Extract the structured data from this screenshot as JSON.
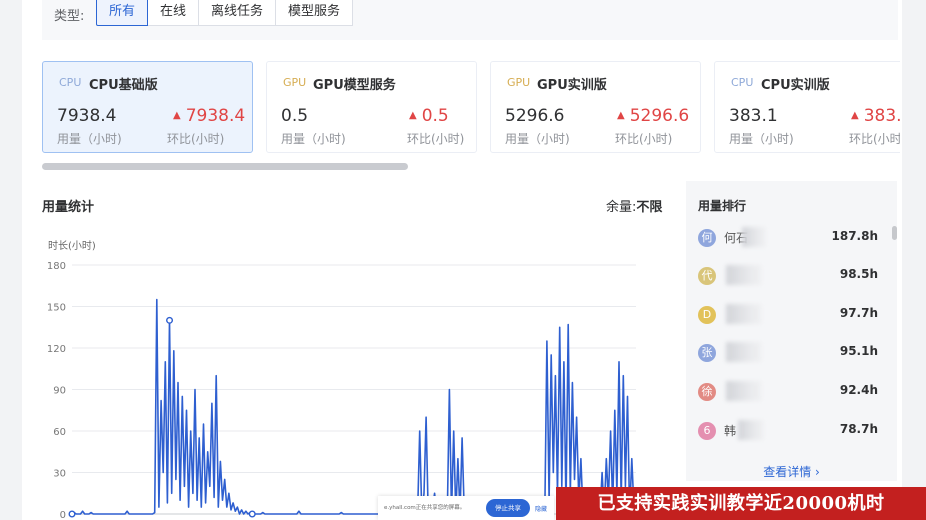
{
  "filter": {
    "label": "类型:",
    "options": [
      "所有",
      "在线",
      "离线任务",
      "模型服务"
    ],
    "active_index": 0
  },
  "cards": [
    {
      "tag": "CPU",
      "title": "CPU基础版",
      "value": "7938.4",
      "change": "7938.4",
      "value_label": "用量（小时)",
      "change_label": "环比(小时)"
    },
    {
      "tag": "GPU",
      "title": "GPU模型服务",
      "value": "0.5",
      "change": "0.5",
      "value_label": "用量（小时)",
      "change_label": "环比(小时)"
    },
    {
      "tag": "GPU",
      "title": "GPU实训版",
      "value": "5296.6",
      "change": "5296.6",
      "value_label": "用量（小时)",
      "change_label": "环比(小时)"
    },
    {
      "tag": "CPU",
      "title": "CPU实训版",
      "value": "383.1",
      "change": "383.",
      "value_label": "用量（小时)",
      "change_label": "环比(小时"
    }
  ],
  "usage": {
    "title": "用量统计",
    "remain_label": "余量:",
    "remain_value": "不限"
  },
  "chart_data": {
    "type": "line",
    "ylabel": "时长(小时)",
    "ylim": [
      0,
      180
    ],
    "yticks": [
      0,
      30,
      60,
      90,
      120,
      150,
      180
    ],
    "grid": true,
    "series_color": "#2e5fd0",
    "series": [
      {
        "name": "",
        "values": [
          0,
          1,
          0,
          0,
          0,
          2,
          0,
          0,
          0,
          1,
          0,
          0,
          0,
          0,
          0,
          0,
          0,
          0,
          0,
          0,
          0,
          0,
          0,
          0,
          0,
          0,
          2,
          0,
          0,
          0,
          0,
          0,
          0,
          0,
          0,
          0,
          0,
          0,
          0,
          1,
          155,
          5,
          82,
          30,
          110,
          8,
          140,
          15,
          118,
          25,
          95,
          10,
          85,
          20,
          75,
          5,
          60,
          15,
          90,
          10,
          55,
          5,
          65,
          8,
          45,
          20,
          80,
          12,
          100,
          5,
          38,
          10,
          25,
          5,
          15,
          3,
          8,
          2,
          5,
          0,
          3,
          0,
          2,
          0,
          1,
          0,
          0,
          0,
          0,
          0,
          1,
          0,
          0,
          0,
          0,
          0,
          0,
          0,
          0,
          0,
          0,
          0,
          0,
          0,
          0,
          0,
          0,
          2,
          0,
          0,
          0,
          0,
          0,
          0,
          0,
          0,
          0,
          0,
          0,
          0,
          0,
          0,
          0,
          0,
          0,
          0,
          0,
          1,
          0,
          0,
          0,
          0,
          0,
          0,
          0,
          0,
          0,
          0,
          0,
          0,
          0,
          0,
          0,
          0,
          0,
          0,
          0,
          0,
          0,
          0,
          0,
          0,
          0,
          0,
          0,
          0,
          0,
          0,
          0,
          0,
          0,
          0,
          1,
          0,
          60,
          0,
          15,
          70,
          0,
          0,
          5,
          15,
          0,
          0,
          0,
          0,
          0,
          0,
          90,
          0,
          60,
          0,
          40,
          0,
          55,
          0,
          10,
          0,
          0,
          0,
          0,
          0,
          0,
          0,
          0,
          0,
          0,
          0,
          0,
          0,
          0,
          0,
          0,
          0,
          0,
          0,
          0,
          0,
          0,
          0,
          0,
          0,
          0,
          0,
          0,
          0,
          0,
          0,
          0,
          0,
          0,
          0,
          0,
          0,
          125,
          10,
          115,
          30,
          100,
          15,
          135,
          20,
          110,
          5,
          137,
          15,
          95,
          25,
          70,
          10,
          40,
          0,
          0,
          0,
          5,
          0,
          0,
          0,
          0,
          0,
          30,
          0,
          40,
          10,
          60,
          5,
          75,
          15,
          110,
          10,
          100,
          20,
          85,
          0,
          40,
          5,
          15
        ]
      }
    ]
  },
  "ranking": {
    "title": "用量排行",
    "items": [
      {
        "avatar": "何",
        "avatar_color": "#8fa6dd",
        "name": "何石",
        "value": "187.8h"
      },
      {
        "avatar": "代",
        "avatar_color": "#d9c57a",
        "name": "",
        "value": "98.5h"
      },
      {
        "avatar": "D",
        "avatar_color": "#e2c25a",
        "name": "",
        "value": "97.7h"
      },
      {
        "avatar": "张",
        "avatar_color": "#8fa6dd",
        "name": "",
        "value": "95.1h"
      },
      {
        "avatar": "徐",
        "avatar_color": "#e28b84",
        "name": "",
        "value": "92.4h"
      },
      {
        "avatar": "6",
        "avatar_color": "#e48fb0",
        "name": "韩",
        "value": "78.7h"
      }
    ],
    "detail_link": "查看详情 ›"
  },
  "share_bar": {
    "text": "e.yhall.com正在共享您的屏幕。",
    "stop_label": "停止共享",
    "hide_label": "隐藏"
  },
  "banner": {
    "text": "已支持实践实训教学近20000机时"
  }
}
